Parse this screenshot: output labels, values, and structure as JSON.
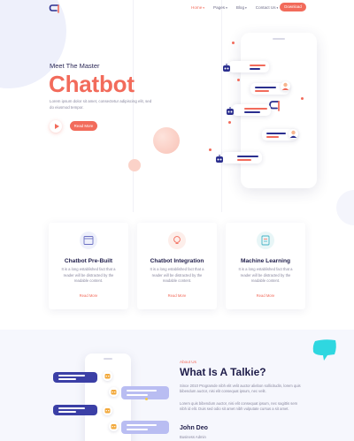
{
  "colors": {
    "accent": "#f26b5b",
    "navy": "#2b2f8f",
    "light_bg": "#f6f7fd"
  },
  "header": {
    "logo": "logo-icon",
    "nav": [
      {
        "label": "Home",
        "caret": "▾"
      },
      {
        "label": "Pages",
        "caret": "▾"
      },
      {
        "label": "Blog",
        "caret": "▾"
      },
      {
        "label": "Contact Us",
        "caret": "▾"
      }
    ],
    "download_label": "Download"
  },
  "hero": {
    "subtitle": "Meet The Master",
    "title": "Chatbot",
    "description": "Lorem ipsum dolor sit amet, consectetur adipiscing elit, sed do eiusmod tempor.",
    "read_more_label": "Read More"
  },
  "features": [
    {
      "icon": "calendar-icon",
      "title": "Chatbot Pre-Built",
      "description": "It is a long established fact that a reader will be distracted by the readable content.",
      "link": "Read More"
    },
    {
      "icon": "lightbulb-icon",
      "title": "Chatbot Integration",
      "description": "It is a long established fact that a reader will be distracted by the readable content.",
      "link": "Read More"
    },
    {
      "icon": "document-icon",
      "title": "Machine Learning",
      "description": "It is a long established fact that a reader will be distracted by the readable content.",
      "link": "Read More"
    }
  ],
  "about": {
    "label": "About Us",
    "title": "What Is A Talkie?",
    "paragraph1": "Since 2010 Programde nibh elit velit auctor aliebon sollicitudin, lorem quis bibendum auctor, nisi elit consequat ipsum, nec velit.",
    "paragraph2": "Lorem quis bibendum auctor, nisi elit consequat ipsum, nec sagittis sem nibh id elit. Duis sed odio sit amet nibh vulputate cursus a sit amet.",
    "name": "John Deo",
    "role": "Business Admin"
  }
}
